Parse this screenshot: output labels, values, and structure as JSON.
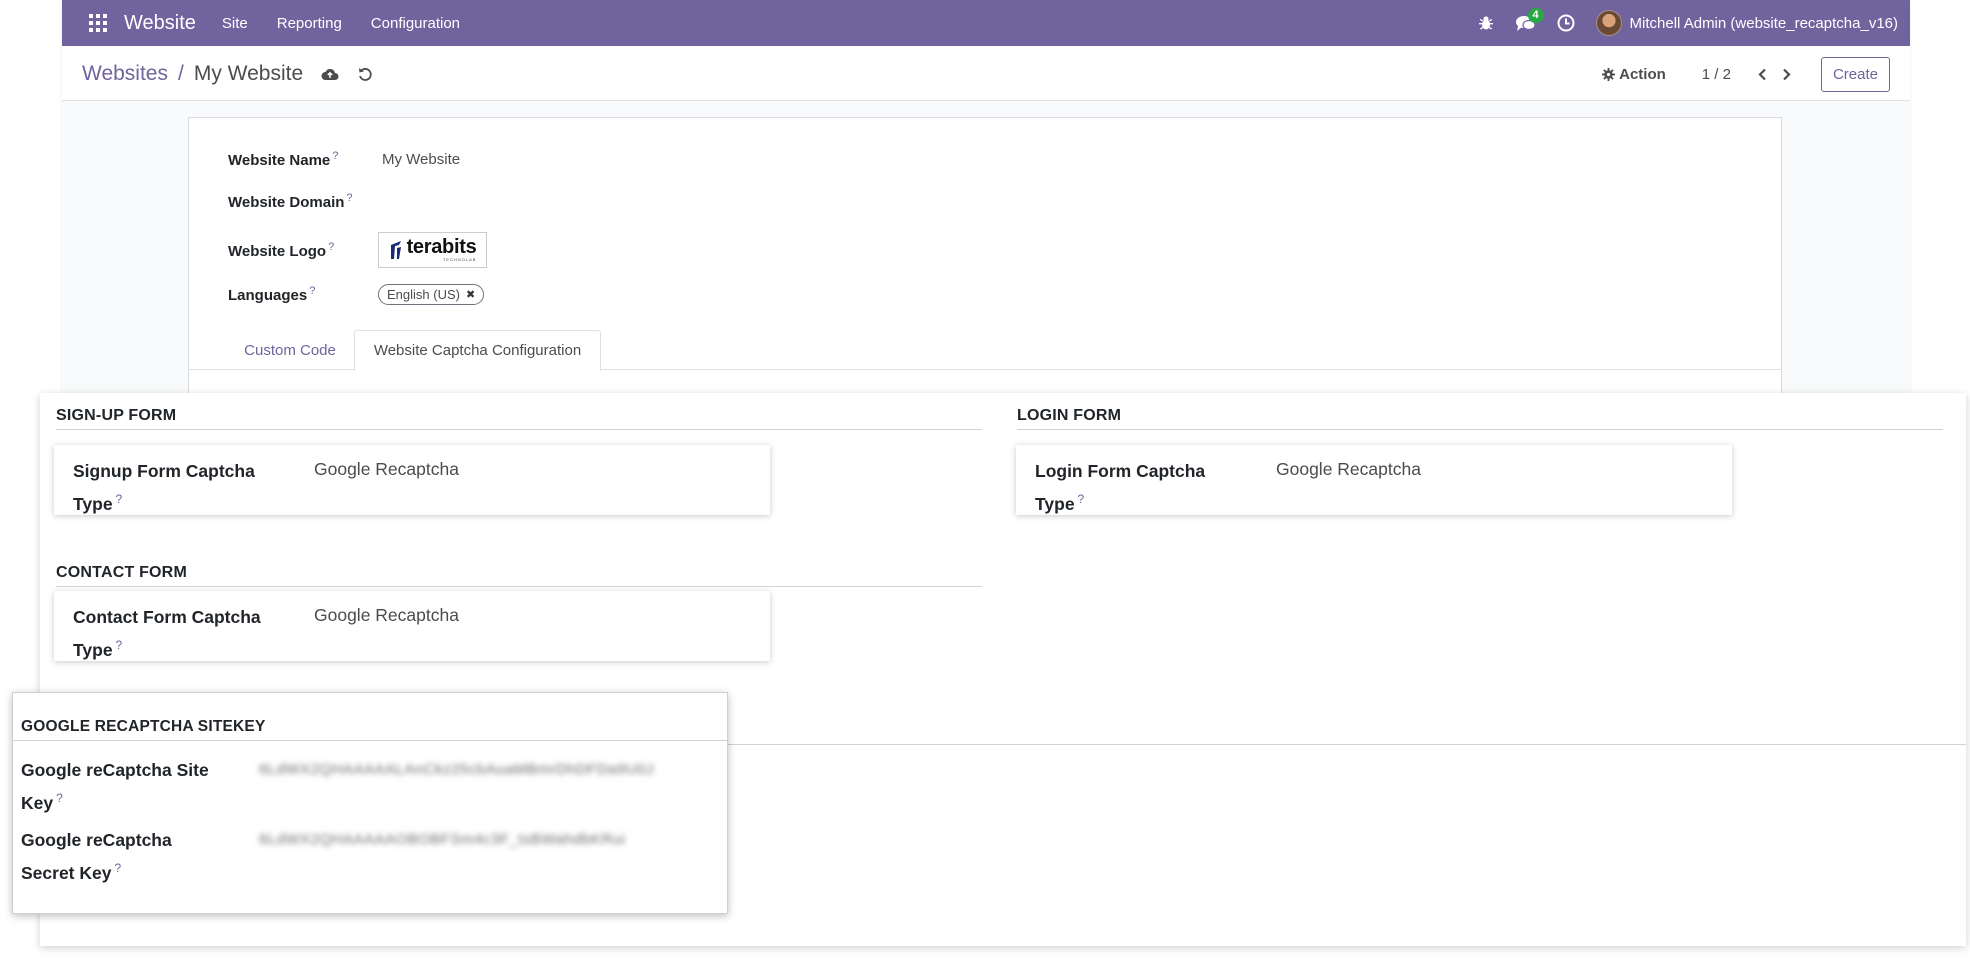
{
  "navbar": {
    "brand": "Website",
    "menus": [
      "Site",
      "Reporting",
      "Configuration"
    ],
    "messages_count": "4",
    "user": "Mitchell Admin (website_recaptcha_v16)",
    "bg_color": "#71639e"
  },
  "control_panel": {
    "breadcrumb_parent": "Websites",
    "breadcrumb_sep": "/",
    "breadcrumb_current": "My Website",
    "action_label": "Action",
    "pager": "1 / 2",
    "create_label": "Create"
  },
  "form": {
    "website_name_label": "Website Name",
    "website_name_value": "My Website",
    "website_domain_label": "Website Domain",
    "website_logo_label": "Website Logo",
    "logo_text": "terabits",
    "logo_subtext": "TECHNOLAB",
    "languages_label": "Languages",
    "language_tag": "English (US)",
    "help_mark": "?"
  },
  "tabs": [
    "Custom Code",
    "Website Captcha Configuration"
  ],
  "captcha": {
    "signup_title": "SIGN-UP FORM",
    "signup_label": "Signup Form Captcha Type",
    "signup_value": "Google Recaptcha",
    "login_title": "LOGIN FORM",
    "login_label": "Login Form Captcha Type",
    "login_value": "Google Recaptcha",
    "contact_title": "CONTACT FORM",
    "contact_label": "Contact Form Captcha Type",
    "contact_value": "Google Recaptcha"
  },
  "sitekey": {
    "title": "GOOGLE RECAPTCHA SITEKEY",
    "site_key_label": "Google reCaptcha Site Key",
    "site_key_value": "6LdWX2QHAAAAALAnCkz25cbAuaMBmrDhDFDa9U0J",
    "secret_key_label": "Google reCaptcha Secret Key",
    "secret_key_value": "6LdWX2QHAAAAAOBOBFSm4c3F_tsBWahdbKRui"
  }
}
